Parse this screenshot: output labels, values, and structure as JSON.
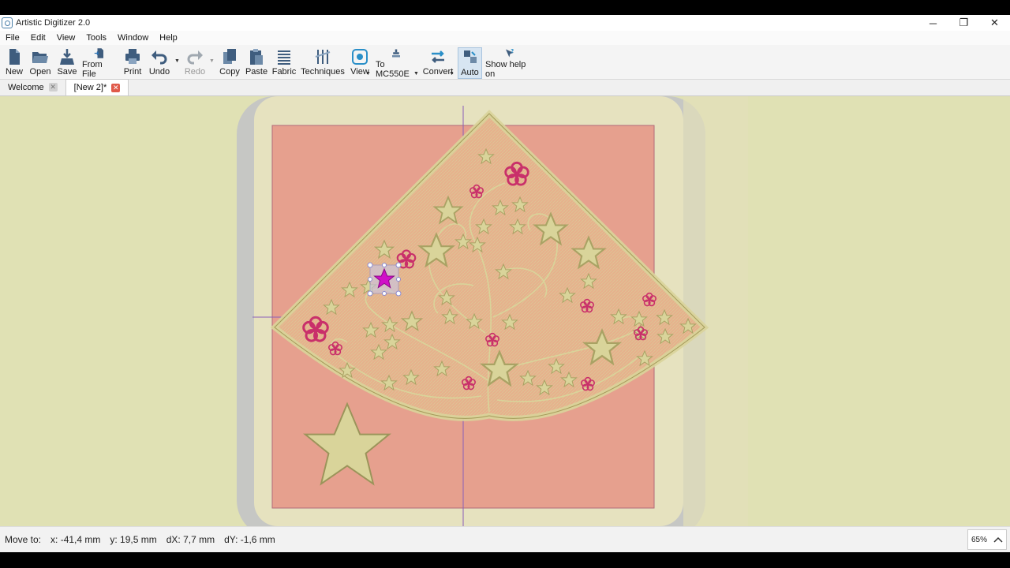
{
  "app": {
    "title": "Artistic Digitizer 2.0",
    "minimize": "─",
    "maximize": "❐",
    "close": "✕"
  },
  "menu": [
    "File",
    "Edit",
    "View",
    "Tools",
    "Window",
    "Help"
  ],
  "toolbar": {
    "new": "New",
    "open": "Open",
    "save": "Save",
    "from_file": "From File",
    "print": "Print",
    "undo": "Undo",
    "redo": "Redo",
    "copy": "Copy",
    "paste": "Paste",
    "fabric": "Fabric",
    "techniques": "Techniques",
    "view": "View",
    "to_machine": "To MC550E",
    "convert": "Convert",
    "auto": "Auto",
    "show_help": "Show help on"
  },
  "tabs": [
    {
      "label": "Welcome",
      "active": false
    },
    {
      "label": "[New 2]*",
      "active": true
    }
  ],
  "status": {
    "label": "Move to:",
    "x": "x: -41,4 mm",
    "y": "y: 19,5 mm",
    "dx": "dX: 7,7 mm",
    "dy": "dY: -1,6 mm",
    "zoom": "65%"
  },
  "colors": {
    "workspace": "#e0e1b4",
    "hoop": "#c8c8c4",
    "fabric": "#e6a08e",
    "thread_gold": "#d9d49a",
    "thread_pink": "#c9306a",
    "selection": "#d010c8"
  }
}
